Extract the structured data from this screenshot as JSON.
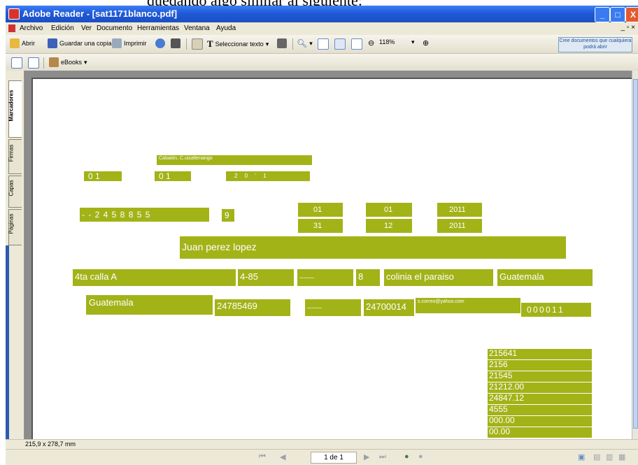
{
  "caption": "quedando algo similar al siguiente:",
  "window": {
    "title": "Adobe Reader - [sat1171blanco.pdf]",
    "min": "_",
    "max": "□",
    "close": "X"
  },
  "menu": [
    "Archivo",
    "Edición",
    "Ver",
    "Documento",
    "Herramientas",
    "Ventana",
    "Ayuda"
  ],
  "mdi_controls": "_ ▫ ×",
  "toolbar": {
    "open": "Abrir",
    "save_copy": "Guardar una copia",
    "print": "Imprimir",
    "select_text": "Seleccionar texto",
    "zoom": "118%",
    "promo": "Cree documentos que cualquiera podrá abrir",
    "ebooks": "eBooks"
  },
  "side_tabs": [
    "Marcadores",
    "Firmas",
    "Capas",
    "Páginas"
  ],
  "form": {
    "municipio": "Cabaión, C.uizaltenango",
    "code_a": "0 1",
    "code_b": "0 1",
    "code_c": "2 0 ' 1",
    "nit": "- - 2 4 5 8 8 5 5",
    "nit_check": "9",
    "period_start": {
      "day": "01",
      "month": "01",
      "year": "2011"
    },
    "period_end": {
      "day": "31",
      "month": "12",
      "year": "2011"
    },
    "name": "Juan perez lopez",
    "address": {
      "street": "4ta calla A",
      "number": "4-85",
      "dashes": "-------",
      "zone": "8",
      "colony": "colinia el paraiso",
      "municipality": "Guatemala"
    },
    "department": "Guatemala",
    "phone": "24785469",
    "phone_dashes": "-------",
    "fax": "24700014",
    "email": "s.correo@yahoo.com",
    "code_digits": "0 0 0 0 1 1",
    "amounts": [
      "215641",
      "2156",
      "21545",
      "21212.00",
      "24847.12",
      "4555",
      "000.00",
      "00.00"
    ]
  },
  "status": {
    "page_size": "215,9 x 278,7 mm"
  },
  "pager": {
    "current": "1 de 1"
  }
}
